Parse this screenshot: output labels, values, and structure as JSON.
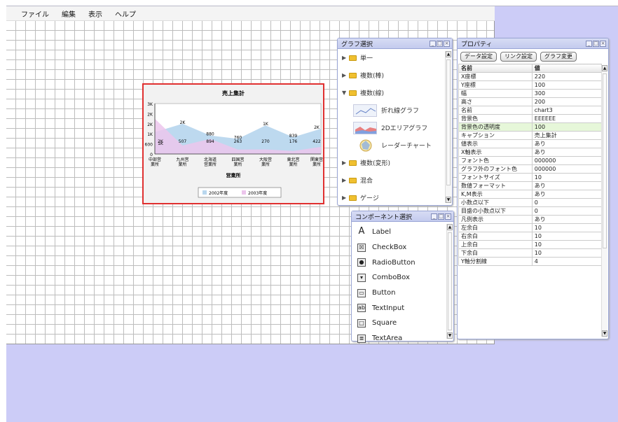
{
  "menu": [
    "ファイル",
    "編集",
    "表示",
    "ヘルプ"
  ],
  "chart_data": {
    "type": "area",
    "title": "売上集計",
    "xlabel": "営業所",
    "ylabel": "",
    "categories": [
      "中部営業所",
      "九州営業所",
      "北海道営業所",
      "四国営業所",
      "大阪営業所",
      "東北営業所",
      "関東営業所"
    ],
    "category_lines": [
      [
        "中部営",
        "業所"
      ],
      [
        "九州営",
        "業所"
      ],
      [
        "北海道",
        "営業所"
      ],
      [
        "四国営",
        "業所"
      ],
      [
        "大阪営",
        "業所"
      ],
      [
        "東北営",
        "業所"
      ],
      [
        "関東営",
        "業所"
      ]
    ],
    "yticks": [
      "3K",
      "2K",
      "2K",
      "1K",
      "600",
      "0"
    ],
    "ylim": [
      0,
      3000
    ],
    "series": [
      {
        "name": "2002年度",
        "values": [
          1300,
          1800,
          1100,
          900,
          1700,
          1000,
          1500
        ],
        "labels": [
          "1K",
          "2K",
          "880",
          "760",
          "1K",
          "839",
          "2K"
        ],
        "color": "#b9d7ee"
      },
      {
        "name": "2003年度",
        "values": [
          2100,
          507,
          894,
          263,
          270,
          176,
          422
        ],
        "labels": [
          "2K",
          "507",
          "894",
          "263",
          "270",
          "176",
          "422"
        ],
        "color": "#ecc5ec"
      }
    ],
    "top_labels": [
      "2K",
      "2K",
      "1K",
      "2K"
    ],
    "legend_position": "bottom"
  },
  "graph_panel": {
    "title": "グラフ選択",
    "items": [
      {
        "label": "単一",
        "arrow": "▶"
      },
      {
        "label": "複数(棒)",
        "arrow": "▶"
      },
      {
        "label": "複数(線)",
        "arrow": "▼"
      }
    ],
    "subitems": [
      {
        "label": "折れ線グラフ",
        "icon": "line-chart-thumb"
      },
      {
        "label": "2Dエリアグラフ",
        "icon": "area-chart-thumb"
      },
      {
        "label": "レーダーチャート",
        "icon": "radar-chart-thumb"
      }
    ],
    "items2": [
      {
        "label": "複数(変形)",
        "arrow": "▶"
      },
      {
        "label": "混合",
        "arrow": "▶"
      },
      {
        "label": "ゲージ",
        "arrow": "▶"
      }
    ]
  },
  "component_panel": {
    "title": "コンポーネント選択",
    "items": [
      {
        "label": "Label",
        "icon": "A"
      },
      {
        "label": "CheckBox",
        "icon": "☒"
      },
      {
        "label": "RadioButton",
        "icon": "●"
      },
      {
        "label": "ComboBox",
        "icon": "▾"
      },
      {
        "label": "Button",
        "icon": "▭"
      },
      {
        "label": "TextInput",
        "icon": "ab"
      },
      {
        "label": "Square",
        "icon": "□"
      },
      {
        "label": "TextArea",
        "icon": "≣"
      }
    ]
  },
  "prop_panel": {
    "title": "プロパティ",
    "buttons": [
      "データ設定",
      "リンク設定",
      "グラフ変更"
    ],
    "col_name": "名前",
    "col_value": "値",
    "rows": [
      [
        "X座標",
        "220"
      ],
      [
        "Y座標",
        "100"
      ],
      [
        "幅",
        "300"
      ],
      [
        "高さ",
        "200"
      ],
      [
        "名前",
        "chart3"
      ],
      [
        "背景色",
        "EEEEEE"
      ],
      [
        "背景色の透明度",
        "100"
      ],
      [
        "キャプション",
        "売上集計"
      ],
      [
        "値表示",
        "あり"
      ],
      [
        "X軸表示",
        "あり"
      ],
      [
        "フォント色",
        "000000"
      ],
      [
        "グラフ外のフォント色",
        "000000"
      ],
      [
        "フォントサイズ",
        "10"
      ],
      [
        "数値フォーマット",
        "あり"
      ],
      [
        "K,M表示",
        "あり"
      ],
      [
        "小数点以下",
        "0"
      ],
      [
        "目盛の小数点以下",
        "0"
      ],
      [
        "凡例表示",
        "あり"
      ],
      [
        "左余白",
        "10"
      ],
      [
        "右余白",
        "10"
      ],
      [
        "上余白",
        "10"
      ],
      [
        "下余白",
        "10"
      ],
      [
        "Y軸分割線",
        "4"
      ]
    ],
    "highlight_row": 6
  }
}
